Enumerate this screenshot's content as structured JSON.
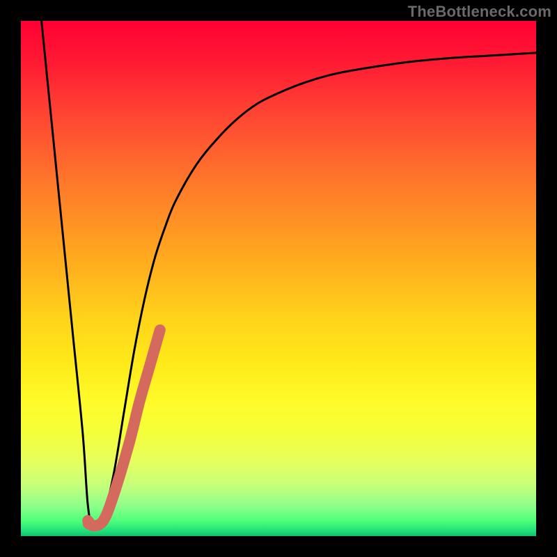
{
  "watermark": "TheBottleneck.com",
  "chart_data": {
    "type": "line",
    "title": "",
    "xlabel": "",
    "ylabel": "",
    "x_range": [
      0,
      100
    ],
    "y_range": [
      0,
      100
    ],
    "grid": false,
    "legend": false,
    "series": [
      {
        "name": "bottleneck-curve",
        "color": "#000000",
        "x": [
          4,
          6,
          8,
          10,
          12,
          13,
          14,
          16,
          18,
          20,
          22,
          24,
          26,
          28,
          30,
          34,
          38,
          42,
          46,
          50,
          55,
          60,
          65,
          70,
          75,
          80,
          85,
          90,
          95,
          100
        ],
        "y": [
          100,
          80,
          60,
          40,
          20,
          6,
          2,
          4,
          12,
          24,
          36,
          46,
          54,
          60,
          65,
          72,
          77,
          81,
          84,
          86,
          88,
          89.5,
          90.5,
          91.3,
          92,
          92.5,
          92.9,
          93.2,
          93.5,
          93.8
        ]
      },
      {
        "name": "highlight-segment",
        "color": "#d46a5e",
        "x": [
          13,
          14,
          16,
          18,
          21,
          23,
          25,
          27
        ],
        "y": [
          3,
          2,
          3,
          8,
          18,
          26,
          33,
          40
        ]
      }
    ],
    "background_gradient": {
      "top": "#ff0033",
      "mid": "#ffd41a",
      "bottom": "#20e07a"
    }
  }
}
